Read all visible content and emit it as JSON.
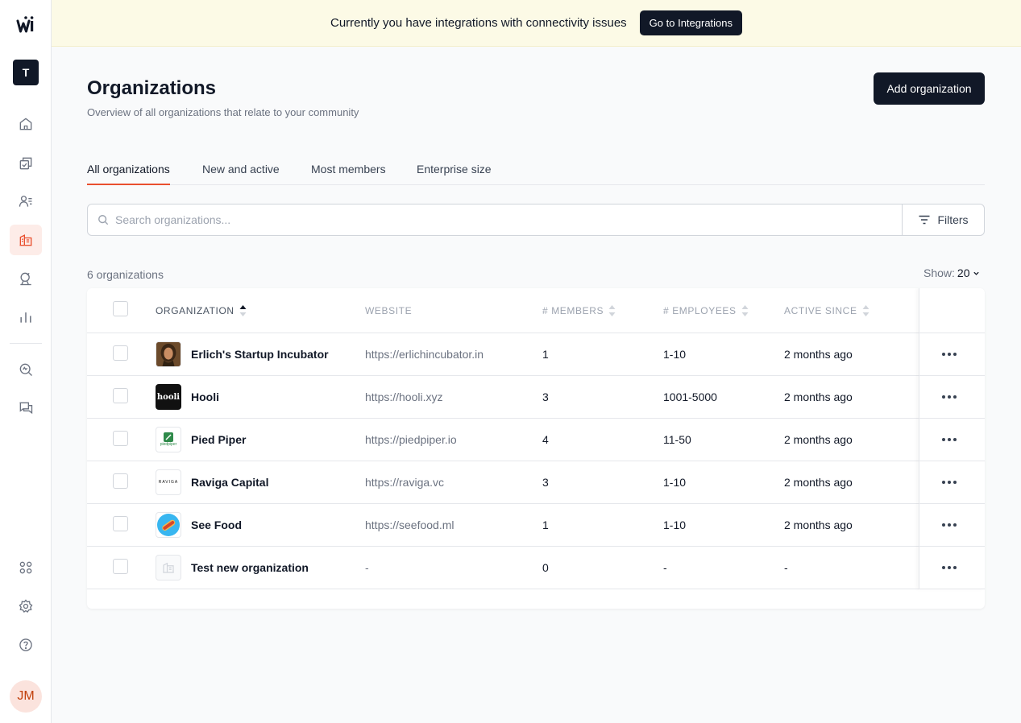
{
  "banner": {
    "message": "Currently you have integrations with connectivity issues",
    "button_label": "Go to Integrations"
  },
  "sidebar": {
    "tenant_initial": "T",
    "user_initials": "JM",
    "items": [
      {
        "icon": "home-icon"
      },
      {
        "icon": "activities-icon"
      },
      {
        "icon": "members-icon"
      },
      {
        "icon": "organizations-icon",
        "active": true
      },
      {
        "icon": "eagle-eye-icon"
      },
      {
        "icon": "reports-icon"
      },
      {
        "icon": "discover-icon"
      },
      {
        "icon": "conversations-icon"
      },
      {
        "icon": "integrations-icon"
      },
      {
        "icon": "settings-icon"
      },
      {
        "icon": "help-icon"
      }
    ]
  },
  "header": {
    "title": "Organizations",
    "subtitle": "Overview of all organizations that relate to your community",
    "add_button": "Add organization"
  },
  "tabs": [
    "All organizations",
    "New and active",
    "Most members",
    "Enterprise size"
  ],
  "search": {
    "placeholder": "Search organizations...",
    "value": "",
    "filters_label": "Filters"
  },
  "list": {
    "count_text": "6 organizations",
    "show_label": "Show:",
    "show_value": "20"
  },
  "table": {
    "columns": [
      "ORGANIZATION",
      "WEBSITE",
      "# MEMBERS",
      "# EMPLOYEES",
      "ACTIVE SINCE"
    ],
    "rows": [
      {
        "name": "Erlich's Startup Incubator",
        "website": "https://erlichincubator.in",
        "members": "1",
        "employees": "1-10",
        "active_since": "2 months ago",
        "logo": "portrait"
      },
      {
        "name": "Hooli",
        "website": "https://hooli.xyz",
        "members": "3",
        "employees": "1001-5000",
        "active_since": "2 months ago",
        "logo": "hooli",
        "logo_text": "hooli"
      },
      {
        "name": "Pied Piper",
        "website": "https://piedpiper.io",
        "members": "4",
        "employees": "11-50",
        "active_since": "2 months ago",
        "logo": "piedpiper",
        "logo_text": "piedpiper"
      },
      {
        "name": "Raviga Capital",
        "website": "https://raviga.vc",
        "members": "3",
        "employees": "1-10",
        "active_since": "2 months ago",
        "logo": "raviga",
        "logo_text": "RAVIGA"
      },
      {
        "name": "See Food",
        "website": "https://seefood.ml",
        "members": "1",
        "employees": "1-10",
        "active_since": "2 months ago",
        "logo": "seefood"
      },
      {
        "name": "Test new organization",
        "website": "-",
        "members": "0",
        "employees": "-",
        "active_since": "-",
        "logo": "placeholder"
      }
    ]
  },
  "colors": {
    "accent": "#e94f2e",
    "dark": "#111827",
    "banner_bg": "#fcfae6"
  }
}
